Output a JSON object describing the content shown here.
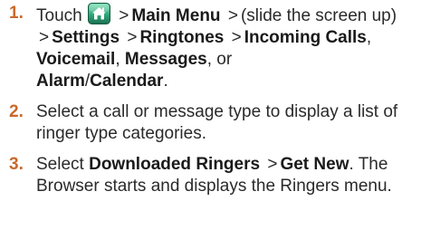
{
  "accent_color": "#c8692b",
  "icons": {
    "home": "home-icon"
  },
  "steps": [
    {
      "number": "1.",
      "touch": "Touch",
      "sep": ">",
      "main_menu": "Main Menu",
      "slide_note": "(slide the screen up)",
      "settings": "Settings",
      "ringtones": "Ringtones",
      "incoming_calls": "Incoming Calls",
      "comma": ",",
      "voicemail": "Voicemail",
      "messages": "Messages",
      "or": "or",
      "alarm": "Alarm",
      "slash": "/",
      "calendar": "Calendar",
      "period": "."
    },
    {
      "number": "2.",
      "text": "Select a call or message type to display a list of ringer type categories."
    },
    {
      "number": "3.",
      "select": "Select",
      "downloaded_ringers": "Downloaded Ringers",
      "sep": ">",
      "get_new": "Get New",
      "period": ".",
      "rest": "The Browser starts and displays the Ringers menu."
    }
  ]
}
